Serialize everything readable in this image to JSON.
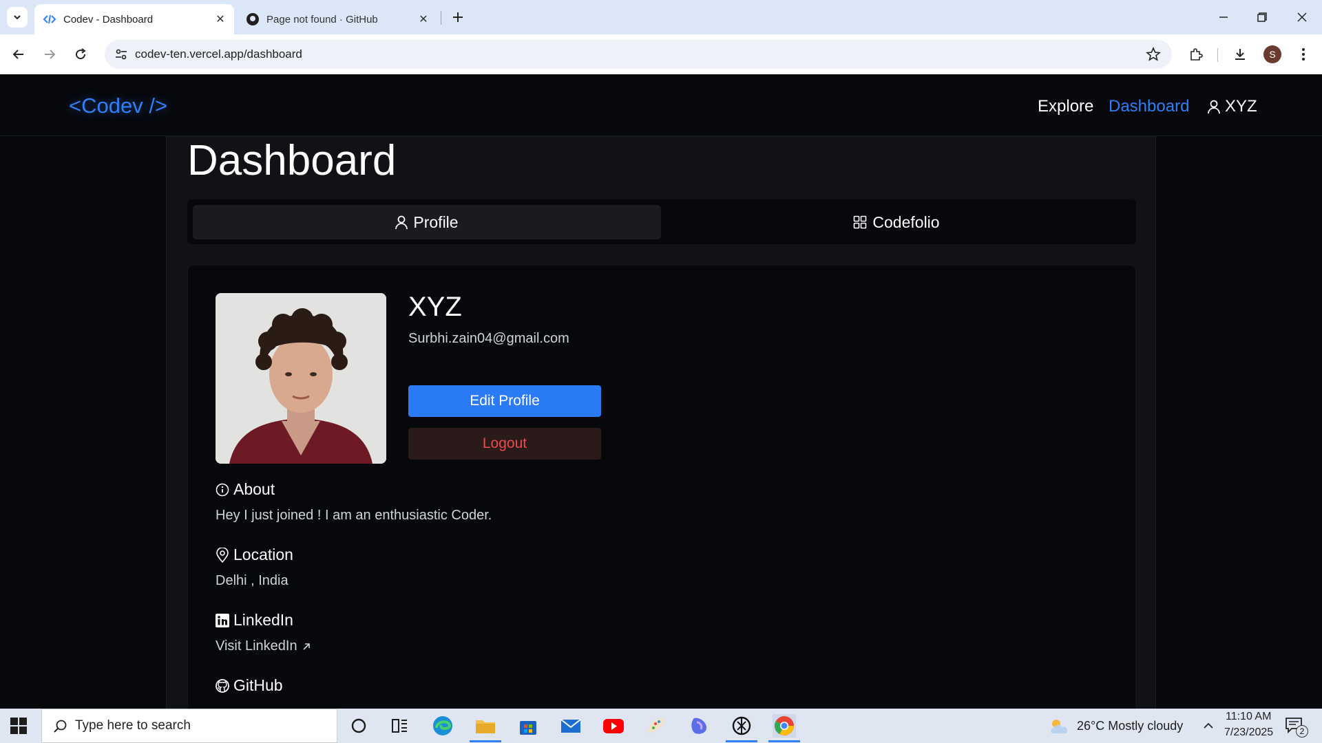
{
  "browser": {
    "tabs": [
      {
        "title": "Codev - Dashboard",
        "active": true
      },
      {
        "title": "Page not found · GitHub",
        "active": false
      }
    ],
    "url": "codev-ten.vercel.app/dashboard",
    "profile_initial": "S"
  },
  "site": {
    "logo": "<Codev />",
    "nav": {
      "explore": "Explore",
      "dashboard": "Dashboard",
      "user": "XYZ"
    },
    "page_title": "Dashboard",
    "tabs": {
      "profile": "Profile",
      "codefolio": "Codefolio"
    },
    "profile": {
      "name": "XYZ",
      "email": "Surbhi.zain04@gmail.com",
      "edit_label": "Edit Profile",
      "logout_label": "Logout",
      "about_title": "About",
      "about_text": "Hey I just joined ! I am an enthusiastic Coder.",
      "location_title": "Location",
      "location_text": "Delhi , India",
      "linkedin_title": "LinkedIn",
      "linkedin_link": "Visit LinkedIn",
      "github_title": "GitHub"
    },
    "colors": {
      "accent": "#2f7ff7",
      "logout": "#ef4a4a",
      "background": "#07080c"
    }
  },
  "taskbar": {
    "search_placeholder": "Type here to search",
    "weather": "26°C  Mostly cloudy",
    "time": "11:10 AM",
    "date": "7/23/2025",
    "notifications": "2"
  }
}
